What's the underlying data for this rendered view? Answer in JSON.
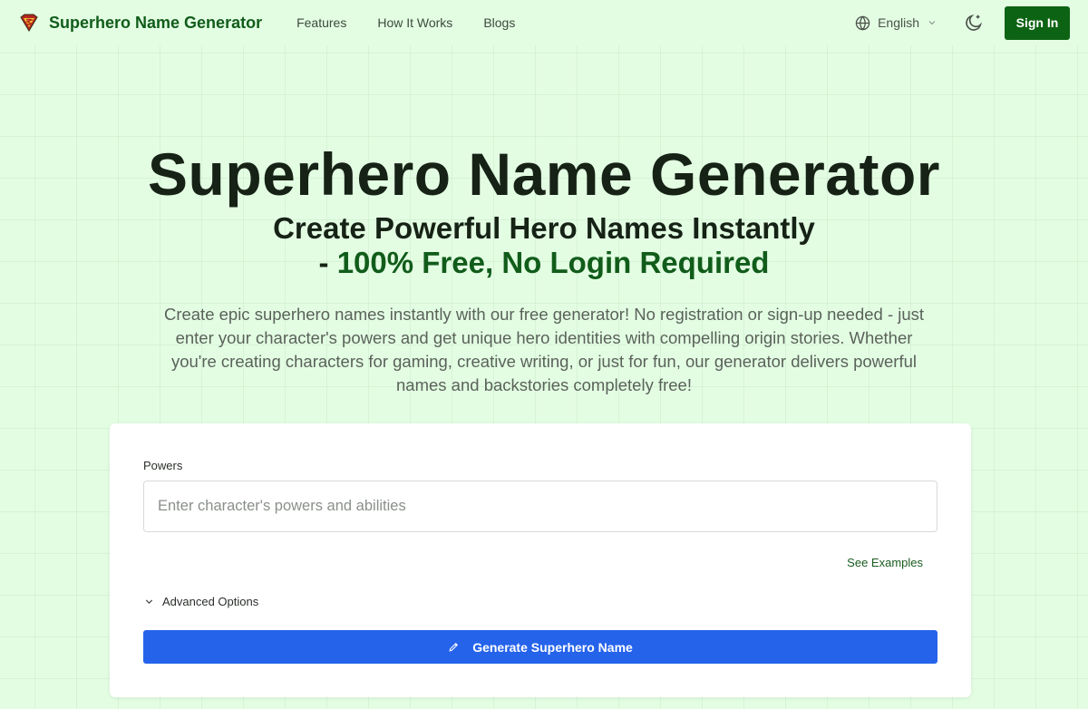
{
  "header": {
    "brand": "Superhero Name Generator",
    "logo_icon": "superman-shield-icon",
    "nav": [
      {
        "label": "Features"
      },
      {
        "label": "How It Works"
      },
      {
        "label": "Blogs"
      }
    ],
    "language": "English",
    "signin_label": "Sign In"
  },
  "hero": {
    "title": "Superhero Name Generator",
    "subtitle_line1": "Create Powerful Hero Names Instantly",
    "subtitle_line2_prefix": "- ",
    "subtitle_line2_accent": "100% Free, No Login Required",
    "description": "Create epic superhero names instantly with our free generator! No registration or sign-up needed - just enter your character's powers and get unique hero identities with compelling origin stories. Whether you're creating characters for gaming, creative writing, or just for fun, our generator delivers powerful names and backstories completely free!"
  },
  "form": {
    "powers_label": "Powers",
    "powers_value": "",
    "powers_placeholder": "Enter character's powers and abilities",
    "see_examples": "See Examples",
    "advanced_options": "Advanced Options",
    "generate_label": "Generate Superhero Name"
  },
  "colors": {
    "page_bg": "#e3fde3",
    "brand_green": "#115c1a",
    "signin_bg": "#0d6314",
    "generate_bg": "#2563eb"
  }
}
